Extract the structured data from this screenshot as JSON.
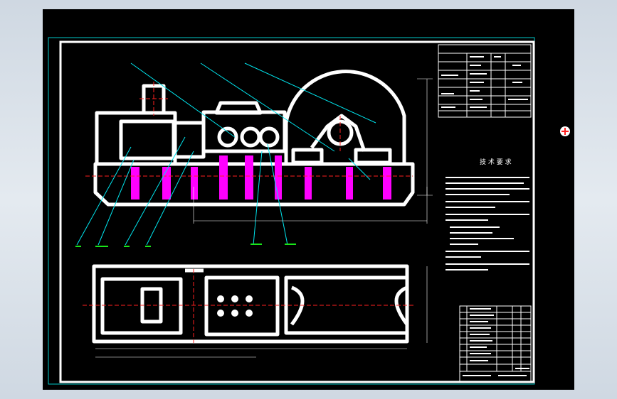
{
  "drawing": {
    "tech_req_title": "技 术 要 求",
    "colors": {
      "background": "#000000",
      "outline": "#ffffff",
      "leader": "#00e5ee",
      "centerline": "#ff2020",
      "bolt": "#ff00ff",
      "label": "#19e619"
    }
  }
}
